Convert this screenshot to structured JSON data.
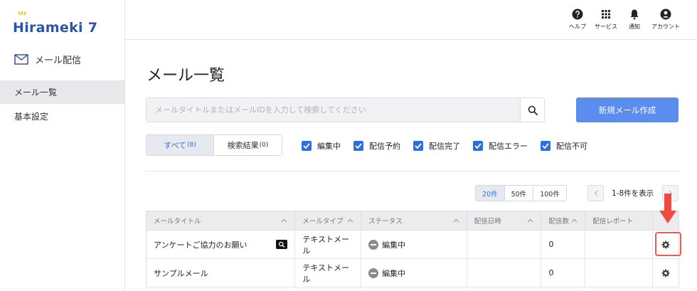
{
  "brand": {
    "name": "Hirameki 7"
  },
  "sidebar": {
    "section_label": "メール配信",
    "items": [
      {
        "label": "メール一覧",
        "active": true
      },
      {
        "label": "基本設定",
        "active": false
      }
    ]
  },
  "header": {
    "icons": [
      {
        "icon": "help-icon",
        "label": "ヘルプ"
      },
      {
        "icon": "apps-grid-icon",
        "label": "サービス"
      },
      {
        "icon": "bell-icon",
        "label": "通知"
      },
      {
        "icon": "account-icon",
        "label": "アカウント"
      }
    ]
  },
  "main": {
    "title": "メール一覧",
    "search": {
      "placeholder": "メールタイトルまたはメールIDを入力して検索してください",
      "value": ""
    },
    "new_button": "新規メール作成",
    "tabs": [
      {
        "label": "すべて",
        "count": "(8)",
        "active": true
      },
      {
        "label": "検索結果",
        "count": "(0)",
        "active": false
      }
    ],
    "filters": [
      {
        "label": "編集中",
        "checked": true
      },
      {
        "label": "配信予約",
        "checked": true
      },
      {
        "label": "配信完了",
        "checked": true
      },
      {
        "label": "配信エラー",
        "checked": true
      },
      {
        "label": "配信不可",
        "checked": true
      }
    ],
    "page_sizes": [
      "20件",
      "50件",
      "100件"
    ],
    "selected_page_size": "20件",
    "range_text": "1-8件を表示",
    "table": {
      "columns": [
        "メールタイトル",
        "メールタイプ",
        "ステータス",
        "配信日時",
        "配信数",
        "配信レポート",
        ""
      ],
      "rows": [
        {
          "title": "アンケートご協力のお願い",
          "type": "テキストメール",
          "status": "編集中",
          "date": "",
          "count": "0",
          "report": ""
        },
        {
          "title": "サンプルメール",
          "type": "テキストメール",
          "status": "編集中",
          "date": "",
          "count": "0",
          "report": ""
        }
      ]
    }
  },
  "colors": {
    "primary": "#5b8def",
    "checkbox": "#2b6fe0",
    "highlight": "#ef5a50",
    "brand": "#2a55a8"
  }
}
